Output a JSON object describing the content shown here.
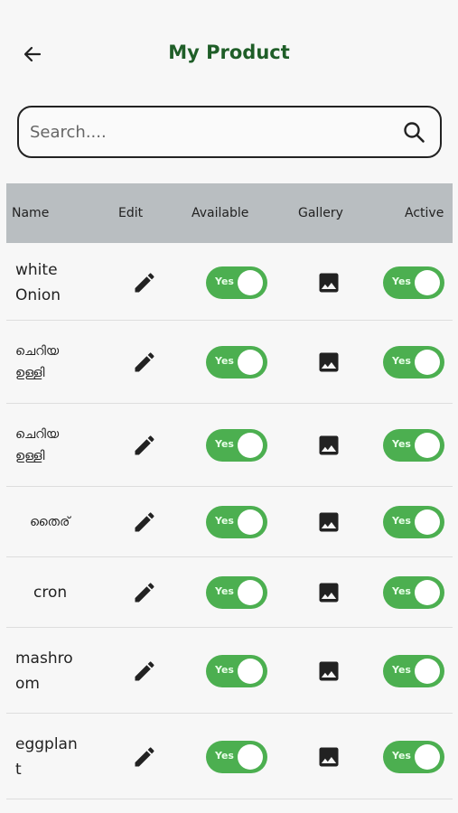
{
  "header": {
    "title": "My Product",
    "back_icon": "arrow-left-icon"
  },
  "search": {
    "placeholder": "Search....",
    "value": "",
    "icon": "search-icon"
  },
  "table": {
    "columns": [
      "Name",
      "Edit",
      "Available",
      "Gallery",
      "Active"
    ],
    "toggle_label": "Yes",
    "toggle_color": "#4caf50",
    "rows": [
      {
        "name": "white\nOnion",
        "available": true,
        "active": true
      },
      {
        "name": "ചെറിയ\nഉള്ളി",
        "available": true,
        "active": true
      },
      {
        "name": "ചെറിയ\nഉള്ളി",
        "available": true,
        "active": true
      },
      {
        "name": "തൈര്",
        "available": true,
        "active": true
      },
      {
        "name": "cron",
        "available": true,
        "active": true
      },
      {
        "name": "mashro\nom",
        "available": true,
        "active": true
      },
      {
        "name": "eggplan\nt",
        "available": true,
        "active": true
      }
    ]
  },
  "icons": {
    "edit": "pencil-icon",
    "gallery": "image-icon"
  }
}
